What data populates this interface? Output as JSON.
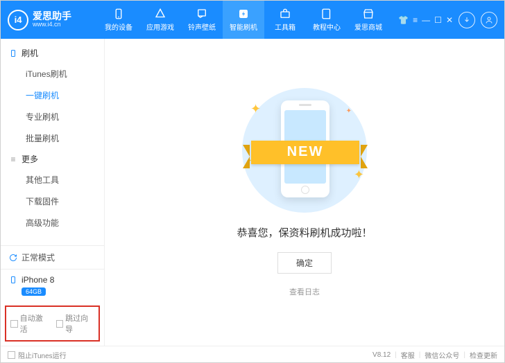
{
  "app": {
    "name": "爱思助手",
    "url": "www.i4.cn"
  },
  "nav": [
    {
      "label": "我的设备"
    },
    {
      "label": "应用游戏"
    },
    {
      "label": "铃声壁纸"
    },
    {
      "label": "智能刷机"
    },
    {
      "label": "工具箱"
    },
    {
      "label": "教程中心"
    },
    {
      "label": "爱思商城"
    }
  ],
  "sidebar": {
    "sections": [
      {
        "title": "刷机",
        "items": [
          {
            "label": "iTunes刷机"
          },
          {
            "label": "一键刷机",
            "active": true
          },
          {
            "label": "专业刷机"
          },
          {
            "label": "批量刷机"
          }
        ]
      },
      {
        "title": "更多",
        "items": [
          {
            "label": "其他工具"
          },
          {
            "label": "下载固件"
          },
          {
            "label": "高级功能"
          }
        ]
      }
    ],
    "mode": "正常模式",
    "device": {
      "name": "iPhone 8",
      "storage": "64GB"
    },
    "options": [
      {
        "label": "自动激活"
      },
      {
        "label": "跳过向导"
      }
    ]
  },
  "main": {
    "ribbon": "NEW",
    "message": "恭喜您，保资料刷机成功啦！",
    "ok": "确定",
    "log": "查看日志"
  },
  "footer": {
    "block": "阻止iTunes运行",
    "version": "V8.12",
    "links": [
      "客服",
      "微信公众号",
      "检查更新"
    ]
  }
}
